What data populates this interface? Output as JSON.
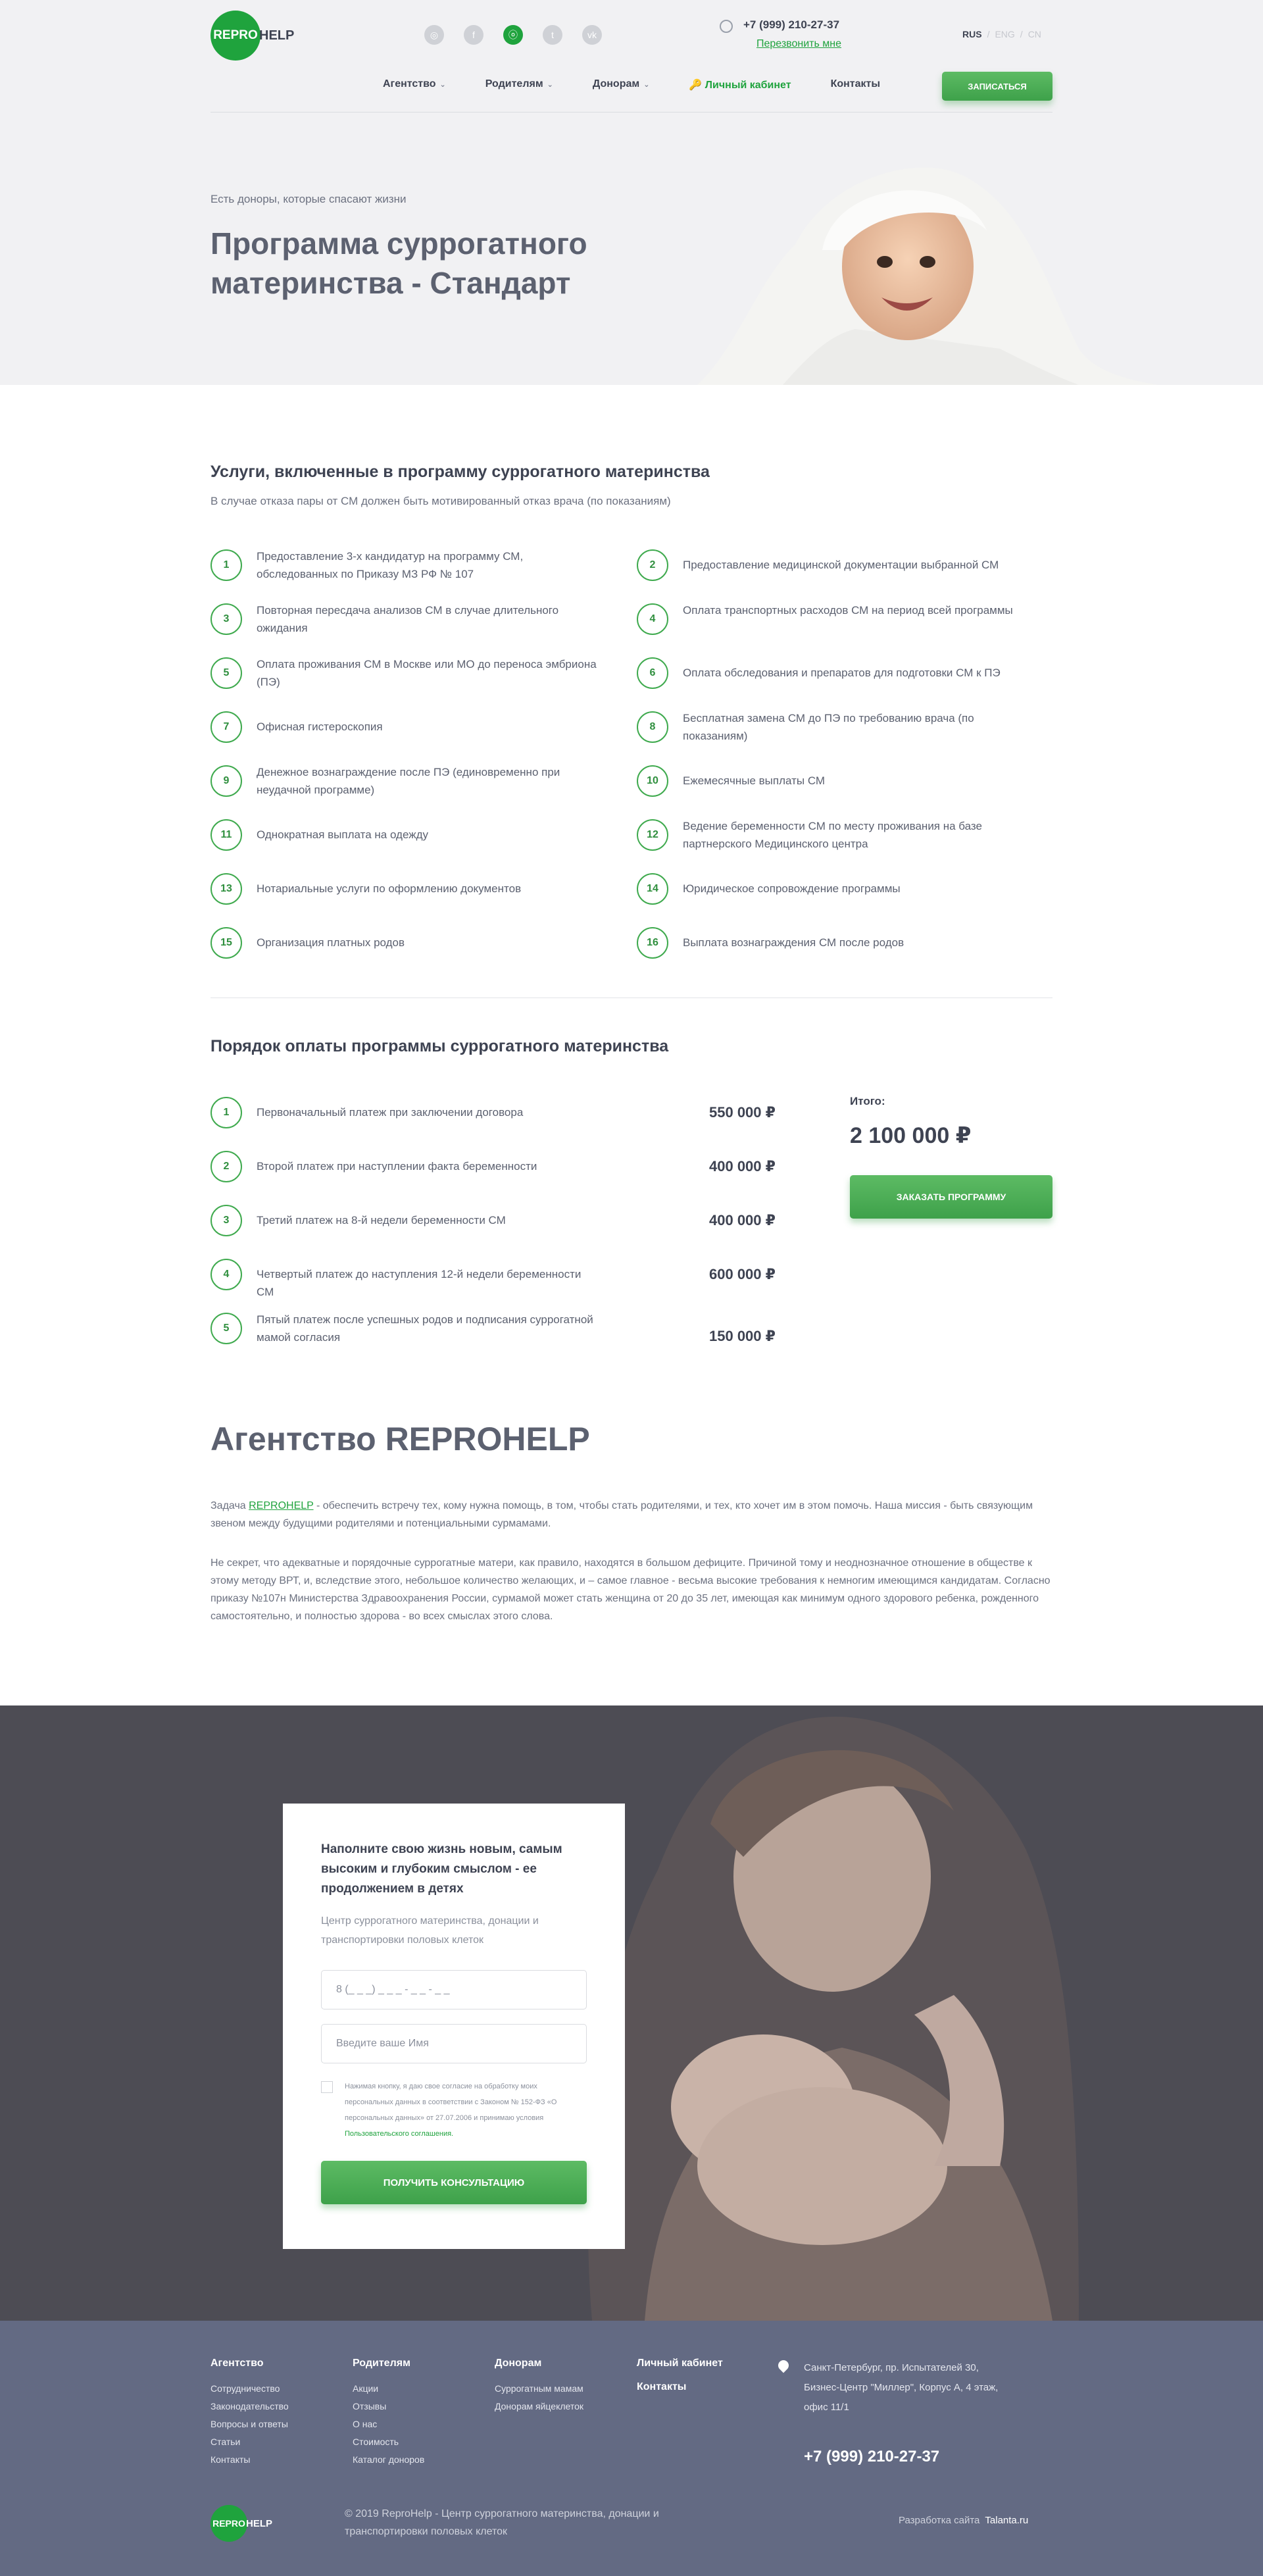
{
  "header": {
    "logo": {
      "circle": "REPRO",
      "rest": "HELP"
    },
    "phone": "+7 (999) 210-27-37",
    "callback": "Перезвонить мне",
    "langs": [
      "RUS",
      "ENG",
      "CN"
    ],
    "nav": [
      {
        "label": "Агентство",
        "dropdown": true
      },
      {
        "label": "Родителям",
        "dropdown": true
      },
      {
        "label": "Донорам",
        "dropdown": true
      },
      {
        "label": "Личный кабинет",
        "dropdown": false
      },
      {
        "label": "Контакты",
        "dropdown": false
      }
    ],
    "signup": "ЗАПИСАТЬСЯ"
  },
  "hero": {
    "subtitle": "Есть доноры, которые спасают жизни",
    "title": "Программа суррогатного материнства - Стандарт"
  },
  "services": {
    "title": "Услуги, включенные в программу суррогатного материнства",
    "note": "В случае отказа пары от СМ должен быть мотивированный отказ врача (по показаниям)",
    "items": [
      {
        "n": "1",
        "text": "Предоставление 3-х кандидатур на программу СМ, обследованных по Приказу МЗ РФ № 107"
      },
      {
        "n": "2",
        "text": "Предоставление медицинской документации выбранной СМ"
      },
      {
        "n": "3",
        "text": "Повторная пересдача анализов СМ в случае длительного ожидания"
      },
      {
        "n": "4",
        "text": "Оплата транспортных расходов СМ на период всей программы"
      },
      {
        "n": "5",
        "text": "Оплата проживания СМ в Москве или МО до переноса эмбриона (ПЭ)"
      },
      {
        "n": "6",
        "text": "Оплата обследования и препаратов для подготовки СМ к ПЭ"
      },
      {
        "n": "7",
        "text": "Офисная гистероскопия"
      },
      {
        "n": "8",
        "text": "Бесплатная замена СМ до ПЭ по требованию врача (по показаниям)"
      },
      {
        "n": "9",
        "text": "Денежное вознаграждение после ПЭ (единовременно при неудачной программе)"
      },
      {
        "n": "10",
        "text": "Ежемесячные выплаты СМ"
      },
      {
        "n": "11",
        "text": "Однократная выплата на одежду"
      },
      {
        "n": "12",
        "text": "Ведение беременности СМ по месту проживания на базе партнерского Медицинского центра"
      },
      {
        "n": "13",
        "text": "Нотариальные услуги по оформлению документов"
      },
      {
        "n": "14",
        "text": "Юридическое сопровождение программы"
      },
      {
        "n": "15",
        "text": "Организация платных родов"
      },
      {
        "n": "16",
        "text": "Выплата вознаграждения СМ после родов"
      }
    ]
  },
  "payment": {
    "title": "Порядок оплаты программы суррогатного материнства",
    "items": [
      {
        "n": "1",
        "text": "Первоначальный платеж при заключении договора",
        "price": "550 000 ₽"
      },
      {
        "n": "2",
        "text": "Второй платеж при наступлении факта беременности",
        "price": "400 000 ₽"
      },
      {
        "n": "3",
        "text": "Третий платеж на 8-й недели беременности СМ",
        "price": "400 000 ₽"
      },
      {
        "n": "4",
        "text": "Четвертый платеж до наступления 12-й недели беременности СМ",
        "price": "600 000 ₽"
      },
      {
        "n": "5",
        "text": "Пятый платеж после успешных родов и подписания суррогатной мамой согласия",
        "price": "150 000 ₽"
      }
    ],
    "total_label": "Итого:",
    "total_value": "2 100 000 ₽",
    "order_button": "ЗАКАЗАТЬ ПРОГРАММУ"
  },
  "agency": {
    "title": "Агентство REPROHELP",
    "p1_before": "Задача ",
    "p1_link": "REPROHELP",
    "p1_after": " - обеспечить встречу тех, кому нужна помощь, в том, чтобы стать родителями, и тех, кто хочет им в этом помочь. Наша миссия - быть связующим звеном между будущими родителями и потенциальными сурмамами.",
    "p2": "Не секрет, что адекватные и порядочные суррогатные матери, как правило, находятся в большом дефиците. Причиной тому и неоднозначное отношение в обществе к этому методу ВРТ, и, вследствие этого, небольшое количество желающих, и – самое главное - весьма высокие требования к немногим имеющимся кандидатам. Согласно приказу №107н Министерства Здравоохранения России, сурмамой может стать женщина от 20 до 35 лет, имеющая как минимум одного здорового ребенка, рожденного самостоятельно, и полностью здорова - во всех смыслах этого слова."
  },
  "form": {
    "title": "Наполните свою жизнь новым, самым высоким и глубоким смыслом - ее продолжением в детях",
    "subtitle": "Центр суррогатного материнства, донации и транспортировки половых клеток",
    "phone_placeholder": "8 (_ _ _) _ _ _ - _ _ - _ _",
    "name_placeholder": "Введите ваше Имя",
    "consent_text": "Нажимая кнопку, я даю свое согласие на обработку моих персональных данных в соответствии с Законом № 152-ФЗ «О персональных данных» от 27.07.2006 и принимаю условия ",
    "consent_link": "Пользовательского соглашения.",
    "submit": "ПОЛУЧИТЬ КОНСУЛЬТАЦИЮ"
  },
  "footer": {
    "columns": [
      {
        "title": "Агентство",
        "items": [
          "Сотрудничество",
          "Законодательство",
          "Вопросы и ответы",
          "Статьи",
          "Контакты"
        ]
      },
      {
        "title": "Родителям",
        "items": [
          "Акции",
          "Отзывы",
          "О нас",
          "Стоимость",
          "Каталог доноров"
        ]
      },
      {
        "title": "Донорам",
        "items": [
          "Суррогатным мамам",
          "Донорам яйцеклеток"
        ]
      },
      {
        "title": "Личный кабинет",
        "items": []
      },
      {
        "title": "Контакты",
        "items": []
      }
    ],
    "address": "Санкт-Петербург, пр. Испытателей 30, Бизнес-Центр \"Миллер\", Корпус А, 4 этаж, офис 11/1",
    "phone": "+7 (999) 210-27-37",
    "copyright": "© 2019 ReproHelp - Центр суррогатного материнства, донации и транспортировки половых клеток",
    "dev_label": "Разработка сайта",
    "dev_name": "Talanta.ru"
  },
  "colors": {
    "accent": "#1fa33d",
    "button": "#4fae58",
    "footer": "#636a83",
    "text": "#5c6170"
  }
}
